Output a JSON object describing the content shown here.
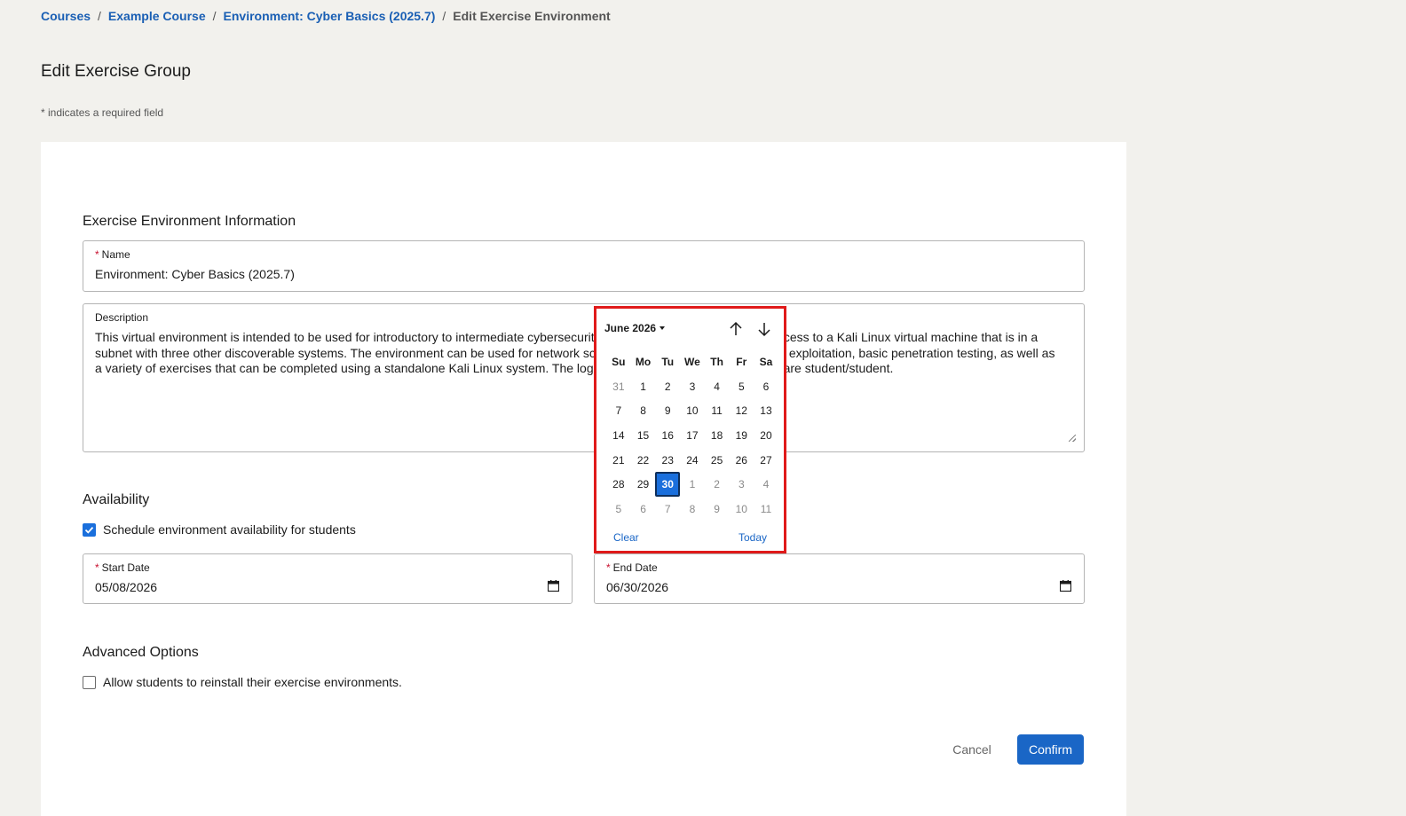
{
  "breadcrumb": {
    "items": [
      "Courses",
      "Example Course",
      "Environment: Cyber Basics (2025.7)"
    ],
    "current": "Edit Exercise Environment",
    "separator": "/"
  },
  "page_title": "Edit Exercise Group",
  "required_note": "* indicates a required field",
  "info_section": {
    "title": "Exercise Environment Information",
    "name": {
      "label": "Name",
      "value": "Environment: Cyber Basics (2025.7)"
    },
    "description": {
      "label": "Description",
      "value": "This virtual environment is intended to be used for introductory to intermediate cybersecurity exercises. Students are given access to a Kali Linux virtual machine that is in a subnet with three other discoverable systems. The environment can be used for network scanning, vulnerability discovery and exploitation, basic penetration testing, as well as a variety of exercises that can be completed using a standalone Kali Linux system. The login credentials for the Kali machine are student/student."
    }
  },
  "availability": {
    "title": "Availability",
    "schedule_checkbox": {
      "label": "Schedule environment availability for students",
      "checked": true
    },
    "start_date": {
      "label": "Start Date",
      "value": "05/08/2026"
    },
    "end_date": {
      "label": "End Date",
      "value": "06/30/2026"
    }
  },
  "advanced": {
    "title": "Advanced Options",
    "reinstall_checkbox": {
      "label": "Allow students to reinstall their exercise environments.",
      "checked": false
    }
  },
  "actions": {
    "cancel": "Cancel",
    "confirm": "Confirm"
  },
  "calendar": {
    "month_label": "June 2026",
    "weekdays": [
      "Su",
      "Mo",
      "Tu",
      "We",
      "Th",
      "Fr",
      "Sa"
    ],
    "days": [
      {
        "d": "31",
        "muted": true
      },
      {
        "d": "1"
      },
      {
        "d": "2"
      },
      {
        "d": "3"
      },
      {
        "d": "4"
      },
      {
        "d": "5"
      },
      {
        "d": "6"
      },
      {
        "d": "7"
      },
      {
        "d": "8"
      },
      {
        "d": "9"
      },
      {
        "d": "10"
      },
      {
        "d": "11"
      },
      {
        "d": "12"
      },
      {
        "d": "13"
      },
      {
        "d": "14"
      },
      {
        "d": "15"
      },
      {
        "d": "16"
      },
      {
        "d": "17"
      },
      {
        "d": "18"
      },
      {
        "d": "19"
      },
      {
        "d": "20"
      },
      {
        "d": "21"
      },
      {
        "d": "22"
      },
      {
        "d": "23"
      },
      {
        "d": "24"
      },
      {
        "d": "25"
      },
      {
        "d": "26"
      },
      {
        "d": "27"
      },
      {
        "d": "28"
      },
      {
        "d": "29"
      },
      {
        "d": "30",
        "selected": true
      },
      {
        "d": "1",
        "muted": true
      },
      {
        "d": "2",
        "muted": true
      },
      {
        "d": "3",
        "muted": true
      },
      {
        "d": "4",
        "muted": true
      },
      {
        "d": "5",
        "muted": true
      },
      {
        "d": "6",
        "muted": true
      },
      {
        "d": "7",
        "muted": true
      },
      {
        "d": "8",
        "muted": true
      },
      {
        "d": "9",
        "muted": true
      },
      {
        "d": "10",
        "muted": true
      },
      {
        "d": "11",
        "muted": true
      }
    ],
    "clear": "Clear",
    "today": "Today"
  },
  "colors": {
    "link": "#1a5fb4",
    "primary": "#1a66c6",
    "highlight_border": "#e01a1a",
    "background": "#f2f1ed"
  }
}
